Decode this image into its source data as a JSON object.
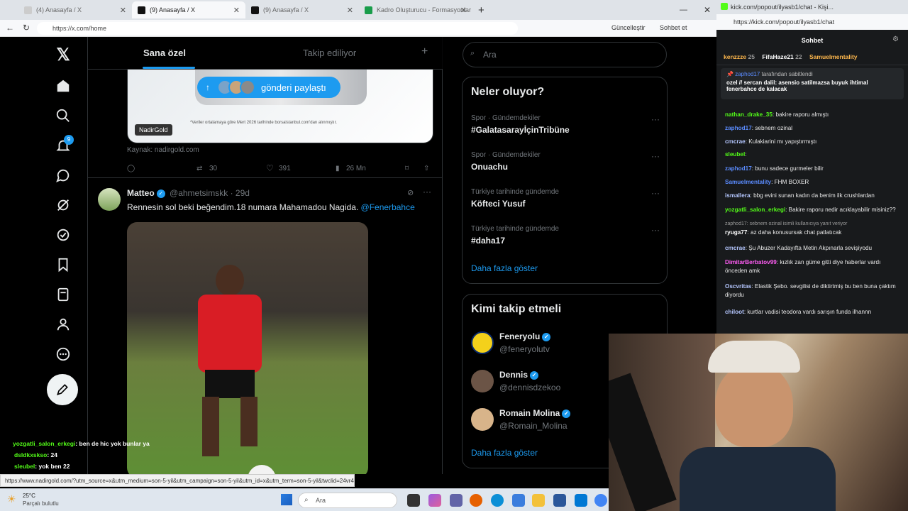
{
  "browser": {
    "tabs": [
      "(4) Anasayfa / X",
      "(9) Anasayfa / X",
      "(9) Anasayfa / X",
      "Kadro Oluşturucu - Formasyonlar"
    ],
    "url": "https://x.com/home",
    "update_label": "Güncelleştir",
    "chat_label": "Sohbet et"
  },
  "x": {
    "tabs": [
      "Sana özel",
      "Takip ediliyor"
    ],
    "card": {
      "share_label": "gönderi paylaştı",
      "brand_badge": "NadirGold",
      "disclaimer": "*Veriler ortalamaya göre Mert 2026 tarihinde borsaistanbul.com'dan alınmıştır.",
      "source": "Kaynak: nadirgold.com",
      "retweets": "30",
      "likes": "391",
      "views": "26 Mn"
    },
    "tweet2": {
      "name": "Matteo",
      "handle": "@ahmetsimskk",
      "time": "· 29d",
      "text": "Rennesin sol beki beğendim.18 numara Mahamadou Nagida.",
      "mention": "@Fenerbahce"
    },
    "search_placeholder": "Ara",
    "trends_title": "Neler oluyor?",
    "trends": [
      {
        "category": "Spor · Gündemdekiler",
        "name": "#GalatasarayİçinTribüne"
      },
      {
        "category": "Spor · Gündemdekiler",
        "name": "Onuachu"
      },
      {
        "category": "Türkiye tarihinde gündemde",
        "name": "Köfteci Yusuf"
      },
      {
        "category": "Türkiye tarihinde gündemde",
        "name": "#daha17"
      }
    ],
    "show_more": "Daha fazla göster",
    "who_title": "Kimi takip etmeli",
    "who": [
      {
        "name": "Feneryolu",
        "handle": "@feneryolutv"
      },
      {
        "name": "Dennis",
        "handle": "@dennisdzekoo"
      },
      {
        "name": "Romain Molina",
        "handle": "@Romain_Molina"
      }
    ],
    "notif_count": "9"
  },
  "status_url": "https://www.nadirgold.com/?utm_source=x&utm_medium=son-5-yil&utm_campaign=son-5-yil&utm_id=x&utm_term=son-5-yil&twclid=24vr4itcwkranxobow62is980t",
  "overlay_chat": [
    {
      "user": "yozgatli_salon_erkegi",
      "text": "ben de hic yok bunlar ya"
    },
    {
      "user": "dsldkxskso",
      "text": "24"
    },
    {
      "user": "sleubel",
      "text": "yok ben 22"
    }
  ],
  "kick": {
    "tab": "kick.com/popout/ilyasb1/chat - Kişi...",
    "url": "https://kick.com/popout/ilyasb1/chat",
    "title": "Sohbet",
    "leaders": [
      {
        "name": "kenzzze",
        "count": "25"
      },
      {
        "name": "FifaHaze21",
        "count": "22"
      },
      {
        "name": "Samuelmentality",
        "count": ""
      }
    ],
    "pinned_by": "zaphod17",
    "pinned_suffix": "tarafından sabitlendi",
    "pinned_text": "ozel // sercan dalil: asensio satilmazsa buyuk ihtimal fenerbahce de kalacak",
    "messages": [
      {
        "user": "nathan_drake_35",
        "text": "bakire raporu almıştı",
        "color": "#53fc18"
      },
      {
        "user": "zaphod17",
        "text": "sebnem ozinal",
        "color": "#5b8cff"
      },
      {
        "user": "cmcrae",
        "text": "Kulakiarini mı yapıştırmıştı",
        "color": "#b5c7ff"
      },
      {
        "user": "sleubel",
        "text": "",
        "color": "#53fc18"
      },
      {
        "user": "zaphod17",
        "text": "bunu sadece gurmeler bilir",
        "color": "#5b8cff"
      },
      {
        "user": "Samuelmentality",
        "text": "FHM BOXER",
        "color": "#5b8cff"
      },
      {
        "user": "ismallera",
        "text": "bbg evini sunan kadın da benim ilk crushlardan",
        "color": "#b5c7ff"
      },
      {
        "user": "yozgatli_salon_erkegi",
        "text": "Bakire raporu nedir acıklayabilir misiniz??",
        "color": "#53fc18"
      },
      {
        "user": "ryuga77",
        "text": "az daha konusursak chat patlatıcak",
        "color": "#ffffff"
      },
      {
        "user": "cmcrae",
        "text": "Şu Abuzer Kadayıfta Metin Akpınarla sevişiyodu",
        "color": "#b5c7ff"
      },
      {
        "user": "DimitarBerbatov99",
        "text": "kızlık zan güme gitti diye haberlar vardı önceden amk",
        "color": "#ff5cf4"
      },
      {
        "user": "Oscvritas",
        "text": "Elastik Şebo. sevgilisi de diktirtmiş bu ben buna çaktım diyordu",
        "color": "#b5c7ff"
      },
      {
        "user": "chiloot",
        "text": "kurtlar vadisi teodora vardı sarışın funda ilhannn",
        "color": "#b5c7ff"
      }
    ],
    "reply_note": "zaphod17: sebnem ozinal isimli kullanıcıya yanıt veriyor"
  },
  "weather": {
    "temp": "25°C",
    "desc": "Parçalı bulutlu"
  },
  "taskbar_search": "Ara"
}
